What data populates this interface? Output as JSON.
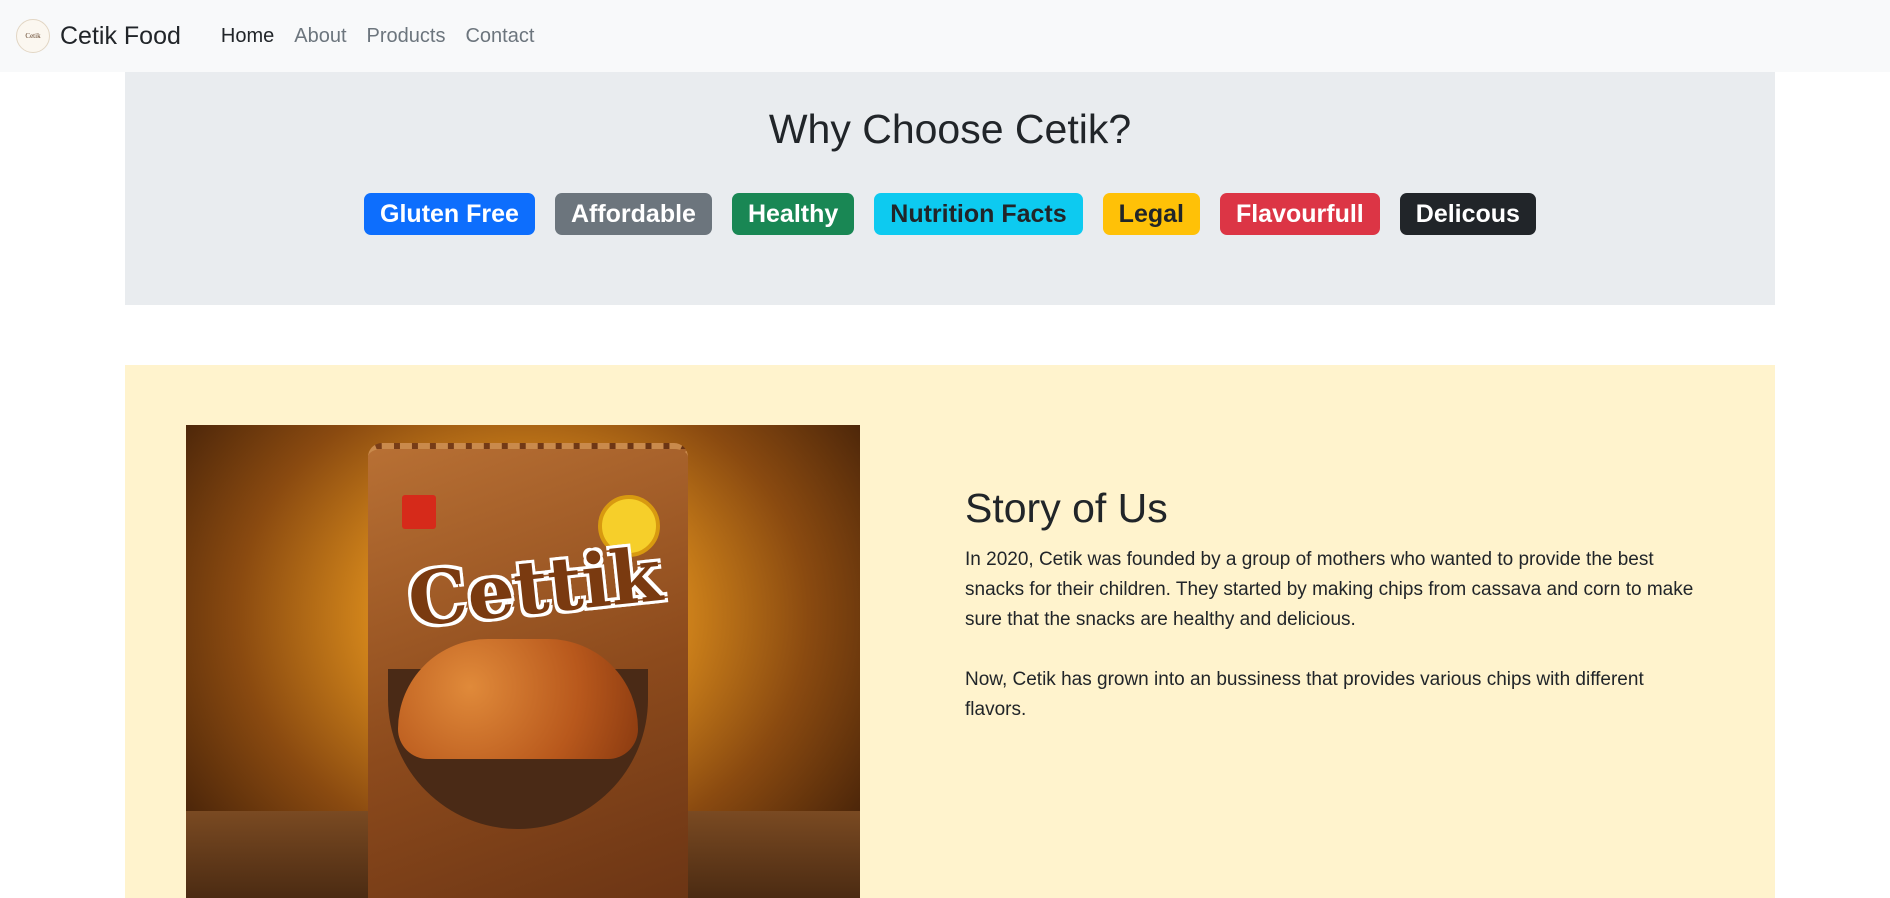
{
  "navbar": {
    "brand_name": "Cetik Food",
    "logo_text": "Cetik",
    "links": [
      "Home",
      "About",
      "Products",
      "Contact"
    ],
    "active": "Home"
  },
  "why": {
    "title": "Why Choose Cetik?",
    "badges": [
      {
        "label": "Gluten Free",
        "color": "#0d6efd"
      },
      {
        "label": "Affordable",
        "color": "#6c757d"
      },
      {
        "label": "Healthy",
        "color": "#198754"
      },
      {
        "label": "Nutrition Facts",
        "color": "#0dcaf0"
      },
      {
        "label": "Legal",
        "color": "#ffc107"
      },
      {
        "label": "Flavourfull",
        "color": "#dc3545"
      },
      {
        "label": "Delicous",
        "color": "#212529"
      }
    ]
  },
  "story": {
    "image_logo_text": "Cettik",
    "title": "Story of Us",
    "paragraphs": [
      "In 2020, Cetik was founded by a group of mothers who wanted to provide the best snacks for their children. They started by making chips from cassava and corn to make sure that the snacks are healthy and delicious.",
      "Now, Cetik has grown into an bussiness that provides various chips with different flavors."
    ]
  }
}
